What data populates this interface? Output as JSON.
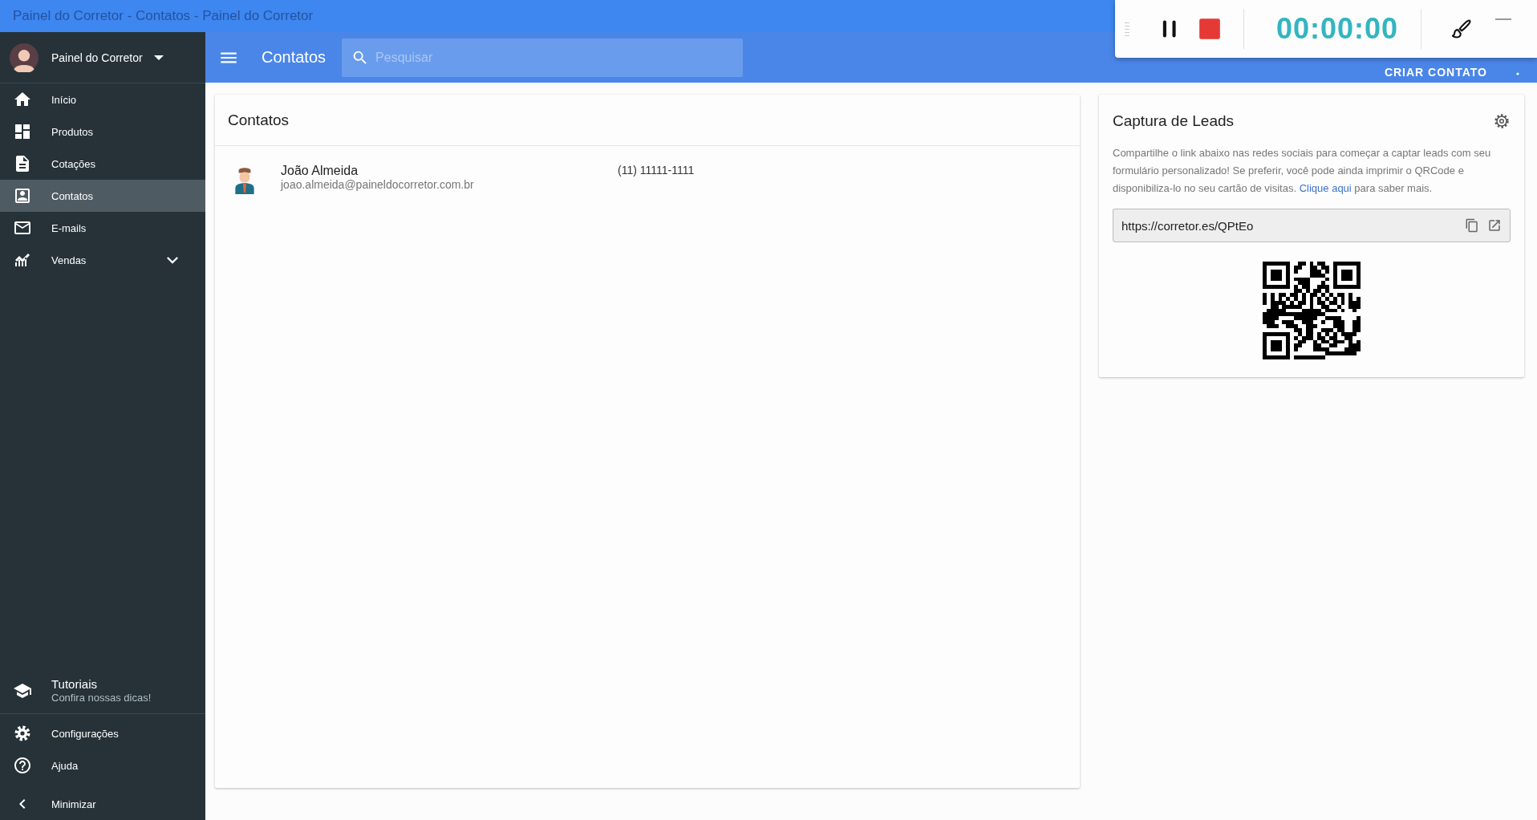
{
  "window": {
    "title": "Painel do Corretor - Contatos - Painel do Corretor"
  },
  "sidebar": {
    "profile": {
      "name": "Painel do Corretor"
    },
    "items": [
      {
        "label": "Início",
        "selected": false
      },
      {
        "label": "Produtos",
        "selected": false
      },
      {
        "label": "Cotações",
        "selected": false
      },
      {
        "label": "Contatos",
        "selected": true
      },
      {
        "label": "E-mails",
        "selected": false
      },
      {
        "label": "Vendas",
        "selected": false,
        "expanded": false
      }
    ],
    "tutorials": {
      "title": "Tutoriais",
      "subtitle": "Confira nossas dicas!"
    },
    "footer_items": [
      {
        "label": "Configurações"
      },
      {
        "label": "Ajuda"
      }
    ],
    "minimize": {
      "label": "Minimizar"
    }
  },
  "header": {
    "title": "Contatos",
    "search": {
      "placeholder": "Pesquisar"
    },
    "action": "CRIAR CONTATO"
  },
  "contacts": {
    "title": "Contatos",
    "rows": [
      {
        "name": "João Almeida",
        "email": "joao.almeida@paineldocorretor.com.br",
        "phone": "(11) 11111-1111"
      }
    ]
  },
  "leads": {
    "title": "Captura de Leads",
    "description": "Compartilhe o link abaixo nas redes sociais para começar a captar leads com seu formulário personalizado! Se preferir, você pode ainda imprimir o QRCode e disponibiliza-lo no seu cartão de visitas.",
    "link": "Clique aqui",
    "description_end": "para saber mais.",
    "url": "https://corretor.es/QPtEo"
  },
  "recorder": {
    "time": "00:00:00"
  }
}
